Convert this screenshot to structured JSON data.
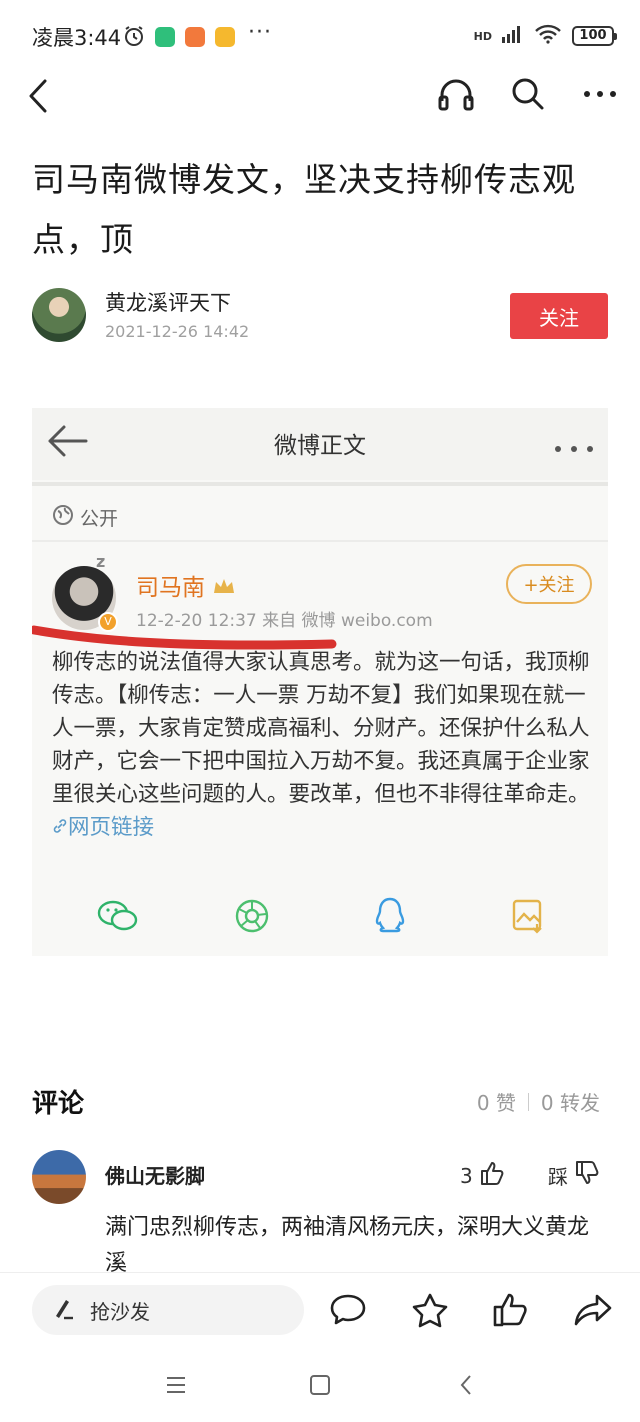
{
  "status_bar": {
    "time": "凌晨3:44",
    "network": "HD",
    "battery": "100",
    "more": "···"
  },
  "article": {
    "title": "司马南微博发文，坚决支持柳传志观点，顶",
    "author": "黄龙溪评天下",
    "date": "2021-12-26 14:42",
    "follow_label": "关注"
  },
  "embed": {
    "nav_title": "微博正文",
    "visibility": "公开",
    "poster_name": "司马南",
    "poster_meta": "12-2-20 12:37  来自 微博 weibo.com",
    "follow_label": "+关注",
    "body": "柳传志的说法值得大家认真思考。就为这一句话，我顶柳传志。【柳传志：一人一票 万劫不复】我们如果现在就一人一票，大家肯定赞成高福利、分财产。还保护什么私人财产，它会一下把中国拉入万劫不复。我还真属于企业家里很关心这些问题的人。要改革，但也不非得往革命走。",
    "link_label": "网页链接"
  },
  "comments": {
    "heading": "评论",
    "likes": "0 赞",
    "reposts": "0 转发",
    "items": [
      {
        "user": "佛山无影脚",
        "like_count": "3",
        "dislike_label": "踩",
        "text": "满门忠烈柳传志，两袖清风杨元庆，深明大义黄龙溪"
      }
    ]
  },
  "bottom_bar": {
    "sofa_label": "抢沙发"
  },
  "colors": {
    "accent_red": "#e94346",
    "weibo_orange": "#e07420",
    "link_blue": "#5b9bc9"
  },
  "icons": [
    "alarm-icon",
    "back-icon",
    "headphones-icon",
    "search-icon",
    "more-icon",
    "globe-icon",
    "crown-icon",
    "wechat-icon",
    "moments-icon",
    "qq-icon",
    "save-image-icon",
    "pen-icon",
    "comment-icon",
    "star-icon",
    "like-icon",
    "share-icon",
    "thumb-up-icon",
    "thumb-down-icon",
    "menu-icon",
    "home-icon",
    "system-back-icon"
  ]
}
